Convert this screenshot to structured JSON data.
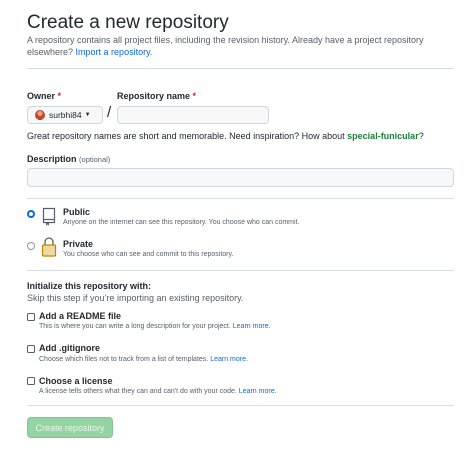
{
  "header": {
    "title": "Create a new repository",
    "subtitle": "A repository contains all project files, including the revision history. Already have a project repository elsewhere?",
    "import_link": "Import a repository."
  },
  "owner": {
    "label": "Owner",
    "required_marker": "*",
    "value": "surbhi84"
  },
  "repo": {
    "label": "Repository name",
    "required_marker": "*",
    "separator": "/",
    "value": ""
  },
  "naming_hint": {
    "prefix": "Great repository names are short and memorable. Need inspiration? How about ",
    "suggestion": "special-funicular",
    "suffix": "?"
  },
  "description": {
    "label": "Description",
    "optional": "(optional)",
    "value": ""
  },
  "visibility": {
    "selected": "public",
    "options": [
      {
        "id": "public",
        "title": "Public",
        "desc": "Anyone on the internet can see this repository. You choose who can commit.",
        "icon": "repo-icon"
      },
      {
        "id": "private",
        "title": "Private",
        "desc": "You choose who can see and commit to this repository.",
        "icon": "lock-icon"
      }
    ]
  },
  "init": {
    "title": "Initialize this repository with:",
    "subtitle": "Skip this step if you’re importing an existing repository.",
    "options": [
      {
        "title": "Add a README file",
        "desc": "This is where you can write a long description for your project.",
        "link": "Learn more.",
        "checked": false
      },
      {
        "title": "Add .gitignore",
        "desc": "Choose which files not to track from a list of templates.",
        "link": "Learn more.",
        "checked": false
      },
      {
        "title": "Choose a license",
        "desc": "A license tells others what they can and can't do with your code.",
        "link": "Learn more.",
        "checked": false
      }
    ]
  },
  "submit": {
    "label": "Create repository",
    "enabled": false
  },
  "colors": {
    "link": "#0969da",
    "required": "#cf222e",
    "suggestion": "#1a7f37",
    "create_button_disabled": "#94d3a2"
  }
}
